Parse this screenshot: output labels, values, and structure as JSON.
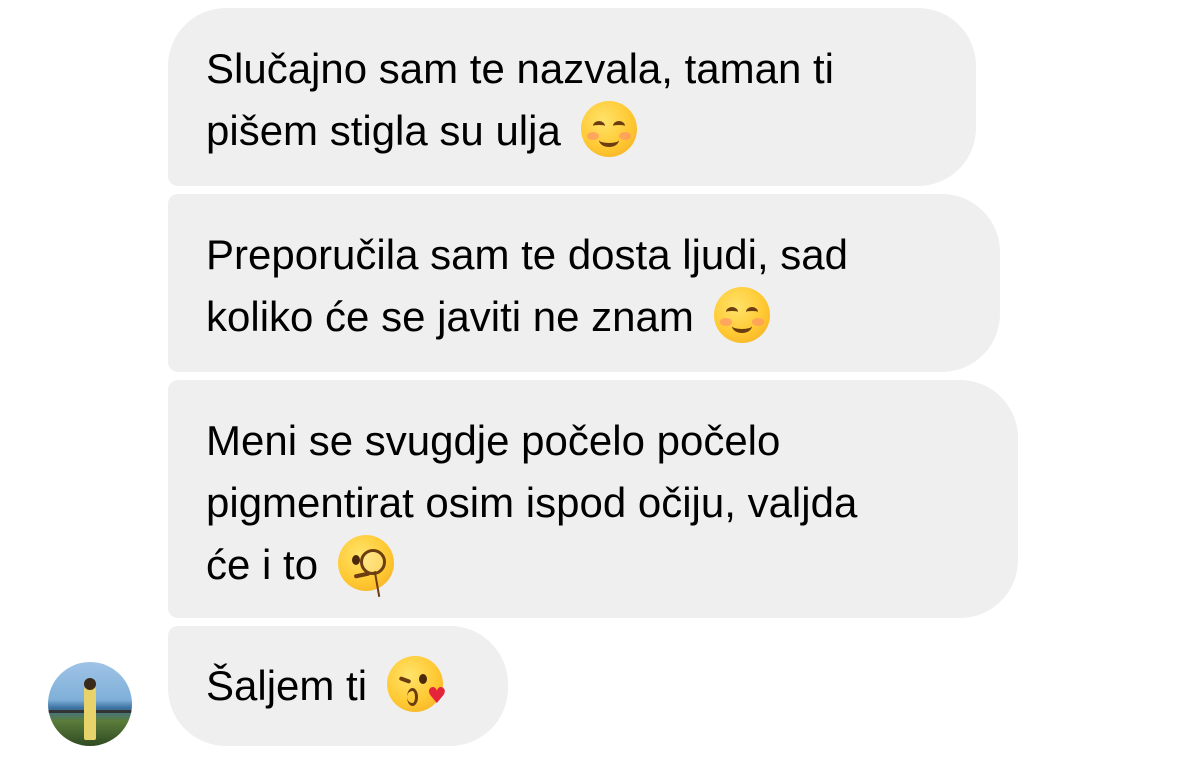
{
  "messages": [
    {
      "lines": [
        "Slučajno sam te nazvala, taman ti",
        "pišem stigla su ulja"
      ],
      "emoji": "smiling-face-icon"
    },
    {
      "lines": [
        "Preporučila sam te dosta ljudi, sad",
        "koliko će se javiti ne znam"
      ],
      "emoji": "smiling-face-icon"
    },
    {
      "lines": [
        "Meni se svugdje počelo počelo",
        "pigmentirat osim ispod očiju, valjda",
        "će i to"
      ],
      "emoji": "face-with-monocle-icon"
    },
    {
      "lines": [
        "Šaljem ti"
      ],
      "emoji": "face-blowing-kiss-icon"
    }
  ],
  "colors": {
    "bubble_bg": "#efefef",
    "text": "#000000",
    "background": "#ffffff"
  }
}
